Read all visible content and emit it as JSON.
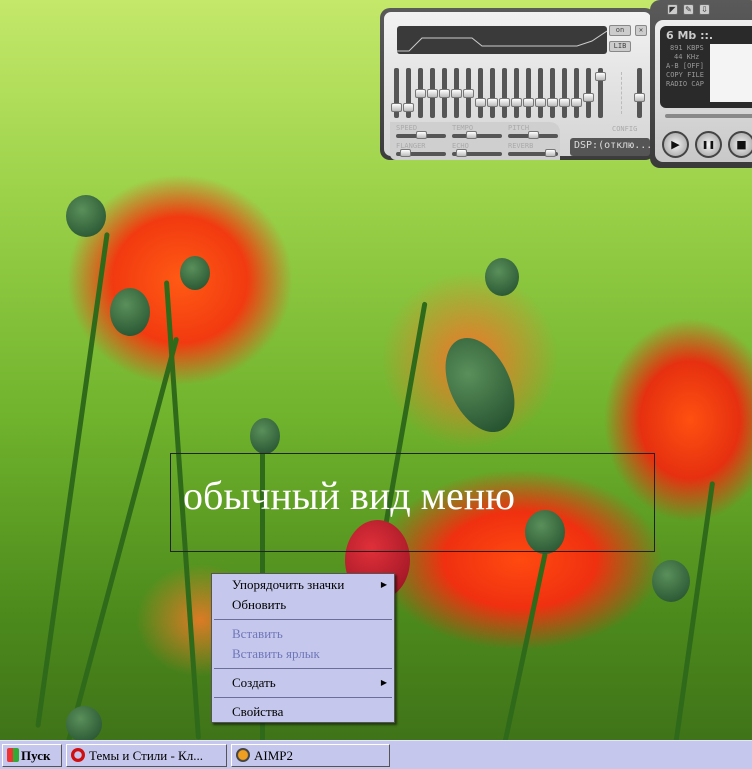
{
  "equalizer": {
    "on_label": "on",
    "lib_label": "LIB",
    "band_levels": [
      0.85,
      0.85,
      0.5,
      0.5,
      0.5,
      0.5,
      0.5,
      0.72,
      0.72,
      0.72,
      0.72,
      0.72,
      0.72,
      0.72,
      0.72,
      0.72,
      0.6,
      0.1
    ],
    "volume_level": 0.6,
    "effects": [
      {
        "label": "SPEED",
        "value": 0.5
      },
      {
        "label": "TEMPO",
        "value": 0.35
      },
      {
        "label": "PITCH",
        "value": 0.5
      },
      {
        "label": "FLANGER",
        "value": 0.1
      },
      {
        "label": "ECHO",
        "value": 0.1
      },
      {
        "label": "REVERB",
        "value": 0.95
      }
    ],
    "config_label": "CONFIG",
    "dsp_label": "DSP:(отклю..."
  },
  "player": {
    "size": "6 Mb ::.",
    "bitrate": "891 KBPS",
    "samplerate": "44 KHz",
    "ab": "A-B [OFF]",
    "copy": "COPY FILE",
    "radio": "RADIO CAP",
    "play": "▶",
    "pause": "❚❚",
    "stop": "■"
  },
  "desktop": {
    "caption": "обычный вид меню"
  },
  "context_menu": {
    "items": [
      {
        "label": "Упорядочить значки",
        "submenu": true
      },
      {
        "label": "Обновить"
      },
      {
        "label": "Вставить",
        "disabled": true
      },
      {
        "label": "Вставить ярлык",
        "disabled": true
      },
      {
        "label": "Создать",
        "submenu": true
      },
      {
        "label": "Свойства"
      }
    ]
  },
  "taskbar": {
    "start": "Пуск",
    "tasks": [
      "Темы и Стили - Кл...",
      "AIMP2"
    ]
  }
}
